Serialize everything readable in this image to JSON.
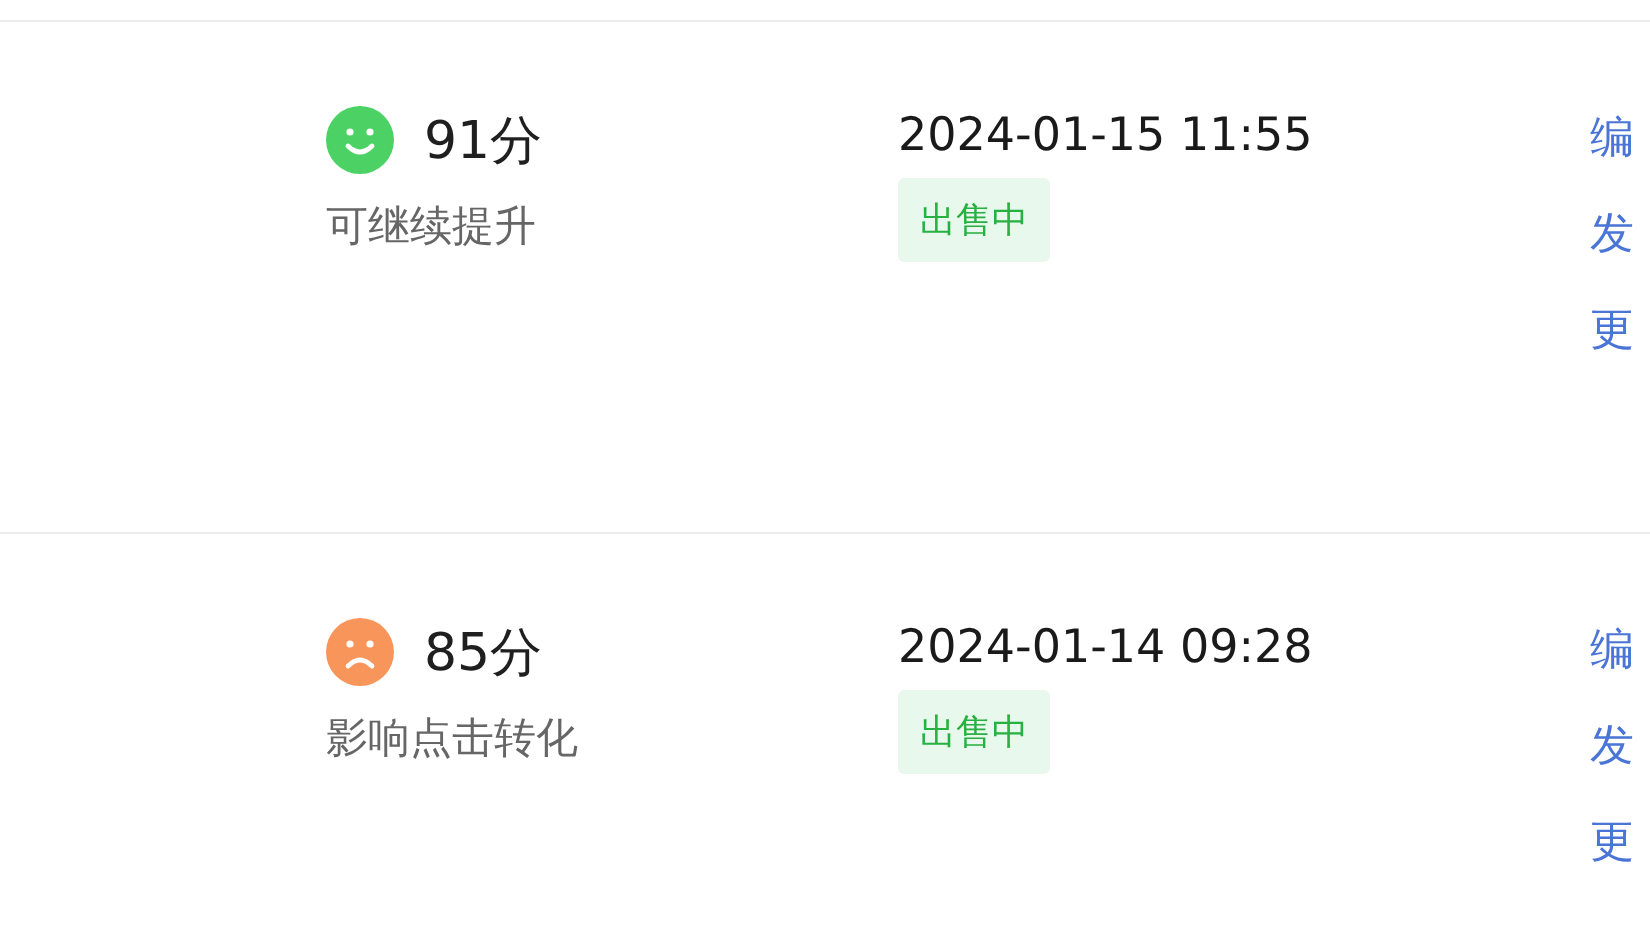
{
  "rows": [
    {
      "score": {
        "kind": "happy",
        "color": "#4cd264",
        "value": "91分",
        "note": "可继续提升"
      },
      "time": "2024-01-15 11:55",
      "status": "出售中",
      "actions": [
        "编",
        "发",
        "更"
      ]
    },
    {
      "score": {
        "kind": "sad",
        "color": "#f7955a",
        "value": "85分",
        "note": "影响点击转化"
      },
      "time": "2024-01-14 09:28",
      "status": "出售中",
      "actions": [
        "编",
        "发",
        "更"
      ]
    }
  ]
}
